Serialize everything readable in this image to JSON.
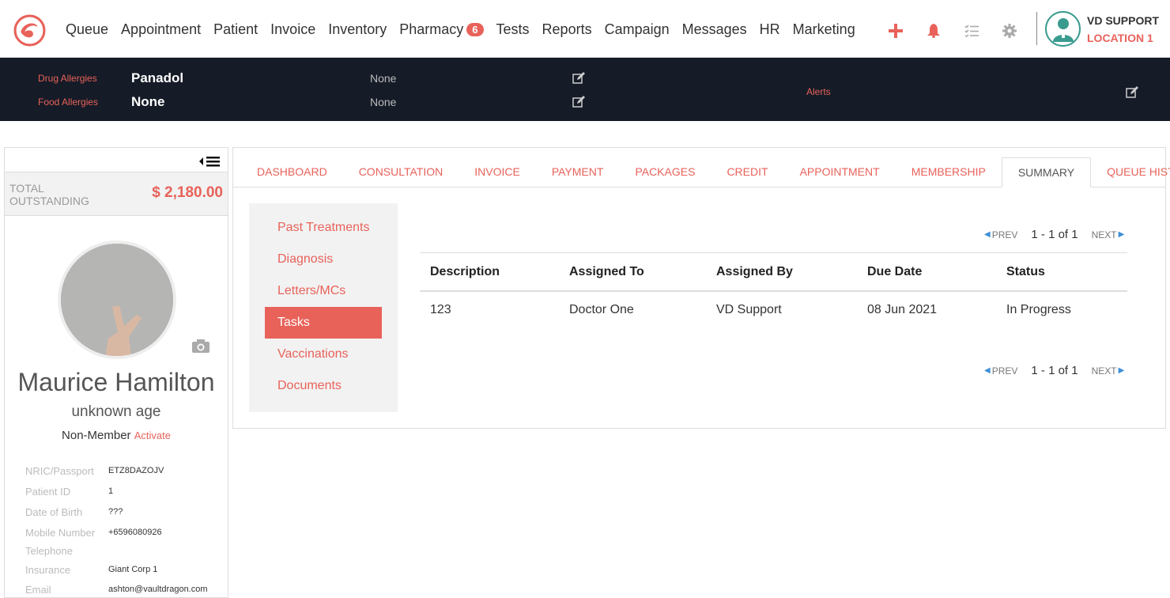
{
  "nav": {
    "items": [
      "Queue",
      "Appointment",
      "Patient",
      "Invoice",
      "Inventory",
      "Pharmacy",
      "Tests",
      "Reports",
      "Campaign",
      "Messages",
      "HR",
      "Marketing"
    ],
    "pharmacy_badge": "6",
    "icons": [
      "plus-icon",
      "bell-icon",
      "tasks-icon",
      "gear-icon"
    ],
    "user_name": "VD SUPPORT",
    "user_location": "LOCATION 1",
    "accent": "#e8625a"
  },
  "allergies": {
    "drug_label": "Drug Allergies",
    "drug_value": "Panadol",
    "drug_note": "None",
    "food_label": "Food Allergies",
    "food_value": "None",
    "food_note": "None",
    "alerts_label": "Alerts"
  },
  "patient": {
    "outstanding_label": "TOTAL OUTSTANDING",
    "outstanding_value": "$ 2,180.00",
    "name": "Maurice Hamilton",
    "age": "unknown age",
    "membership": "Non-Member",
    "activate": "Activate",
    "info": [
      {
        "label": "NRIC/Passport",
        "value": "ETZ8DAZOJV"
      },
      {
        "label": "Patient ID",
        "value": "1"
      },
      {
        "label": "Date of Birth",
        "value": "???"
      },
      {
        "label": "Mobile Number",
        "value": "+6596080926"
      },
      {
        "label": "Telephone",
        "value": ""
      },
      {
        "label": "Insurance",
        "value": "Giant Corp 1"
      },
      {
        "label": "Email",
        "value": "ashton@vaultdragon.com"
      }
    ]
  },
  "tabs": [
    "DASHBOARD",
    "CONSULTATION",
    "INVOICE",
    "PAYMENT",
    "PACKAGES",
    "CREDIT",
    "APPOINTMENT",
    "MEMBERSHIP",
    "SUMMARY",
    "QUEUE HISTORY"
  ],
  "active_tab": "SUMMARY",
  "submenu": [
    "Past Treatments",
    "Diagnosis",
    "Letters/MCs",
    "Tasks",
    "Vaccinations",
    "Documents"
  ],
  "active_submenu": "Tasks",
  "pager": {
    "prev": "PREV",
    "next": "NEXT",
    "info": "1 - 1 of 1"
  },
  "table": {
    "headers": [
      "Description",
      "Assigned To",
      "Assigned By",
      "Due Date",
      "Status"
    ],
    "rows": [
      [
        "123",
        "Doctor One",
        "VD Support",
        "08 Jun 2021",
        "In Progress"
      ]
    ]
  }
}
